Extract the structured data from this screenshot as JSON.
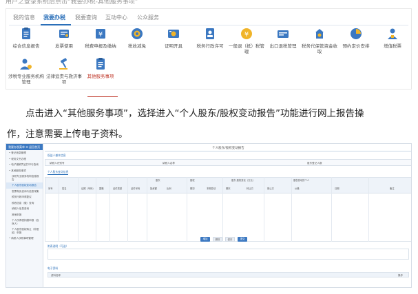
{
  "top_cut_text": "用户之登录系统后点击“我要办税-其他服务事项”",
  "tabs": [
    {
      "label": "我的信息",
      "active": false
    },
    {
      "label": "我要办税",
      "active": true
    },
    {
      "label": "我要查询",
      "active": false
    },
    {
      "label": "互动中心",
      "active": false
    },
    {
      "label": "公众服务",
      "active": false
    }
  ],
  "services": [
    {
      "label": "综合信息报告",
      "icon": "clipboard-icon",
      "color": "#3b78c1"
    },
    {
      "label": "发票使用",
      "icon": "invoice-icon",
      "color": "#3b78c1"
    },
    {
      "label": "税费申报及缴纳",
      "icon": "tax-payment-icon",
      "color": "#3b78c1"
    },
    {
      "label": "税收减免",
      "icon": "tax-relief-icon",
      "color": "#3b78c1"
    },
    {
      "label": "证明开具",
      "icon": "certificate-icon",
      "color": "#3b78c1"
    },
    {
      "label": "税务行政许可",
      "icon": "administrative-permit-icon",
      "color": "#3b78c1"
    },
    {
      "label": "一般退（抵）税管理",
      "icon": "refund-icon",
      "color": "#3b78c1"
    },
    {
      "label": "出口退税管理",
      "icon": "export-refund-icon",
      "color": "#3b78c1"
    },
    {
      "label": "税务代保管资金收取",
      "icon": "fund-custody-icon",
      "color": "#3b78c1"
    },
    {
      "label": "预约定价安排",
      "icon": "pricing-arrangement-icon",
      "color": "#3b78c1"
    },
    {
      "label": "增值税票",
      "icon": "user-ticket-icon",
      "color": "#3b78c1"
    },
    {
      "label": "涉税专业服务机构管理",
      "icon": "service-agency-icon",
      "color": "#3b78c1"
    },
    {
      "label": "法律追责与救济事项",
      "icon": "legal-gavel-icon",
      "color": "#3b78c1"
    },
    {
      "label": "其他服务事项",
      "icon": "other-services-icon",
      "color": "#3b78c1",
      "selected": true
    }
  ],
  "paragraph": {
    "line1": "点击进入“其他服务事项”，选择进入“个人股东/股权变动报告”功能进行网上报告操",
    "line2": "作，注意需要上传电子资料。"
  },
  "embedded": {
    "sidebar_header": "我要办税菜单   ☰ 返回首页",
    "sidebar_items": [
      {
        "label": "• 登记信息管理",
        "sub": false,
        "active": false
      },
      {
        "label": "• 税务文书办理",
        "sub": false,
        "active": false
      },
      {
        "label": "• 电子缴款凭证打印与查询",
        "sub": false,
        "active": false
      },
      {
        "label": "• 其他服务事项",
        "sub": false,
        "active": false
      },
      {
        "label": "涉税专业服务机构信息报告",
        "sub": true,
        "active": false
      },
      {
        "label": "个人股东股权变动报告",
        "sub": true,
        "active": true
      },
      {
        "label": "发票真伪查询与信息采集",
        "sub": true,
        "active": false
      },
      {
        "label": "税务行政申请复议",
        "sub": true,
        "active": false
      },
      {
        "label": "税收信息（缴）查询",
        "sub": true,
        "active": false
      },
      {
        "label": "纳税人信息查询",
        "sub": true,
        "active": false
      },
      {
        "label": "其他申报",
        "sub": true,
        "active": false
      },
      {
        "label": "个人所得税扣缴申报（自然人）",
        "sub": true,
        "active": false
      },
      {
        "label": "个人股东股权转让（非居民）申报",
        "sub": true,
        "active": false
      },
      {
        "label": "• 纳税人涉税事项管理",
        "sub": false,
        "active": false
      }
    ],
    "page_title": "个人股东/股权变动报告",
    "section_basic": "权益人基本信息",
    "info_labels": [
      "纳税人识别号",
      "纳税人名称",
      "股东登记人数"
    ],
    "subtab": "个人股东变动信息",
    "table_group_headers": [
      "股东",
      "股权",
      "股东 股权变化（万元）",
      "股权变动的个人"
    ],
    "table_columns": [
      "序号",
      "姓名",
      "证照（号码）",
      "国籍",
      "证件类型",
      "证件号码",
      "投资额",
      "比例",
      "期初",
      "本期变动",
      "期末",
      "转让方",
      "受让方",
      "价格",
      "日期",
      "备注"
    ],
    "buttons": [
      "增加",
      "删除",
      "保存",
      "提交"
    ],
    "section_note": "附表说明（可选）",
    "section_upload": "电子资料",
    "upload_cols": [
      "资料名称",
      "操作"
    ]
  }
}
